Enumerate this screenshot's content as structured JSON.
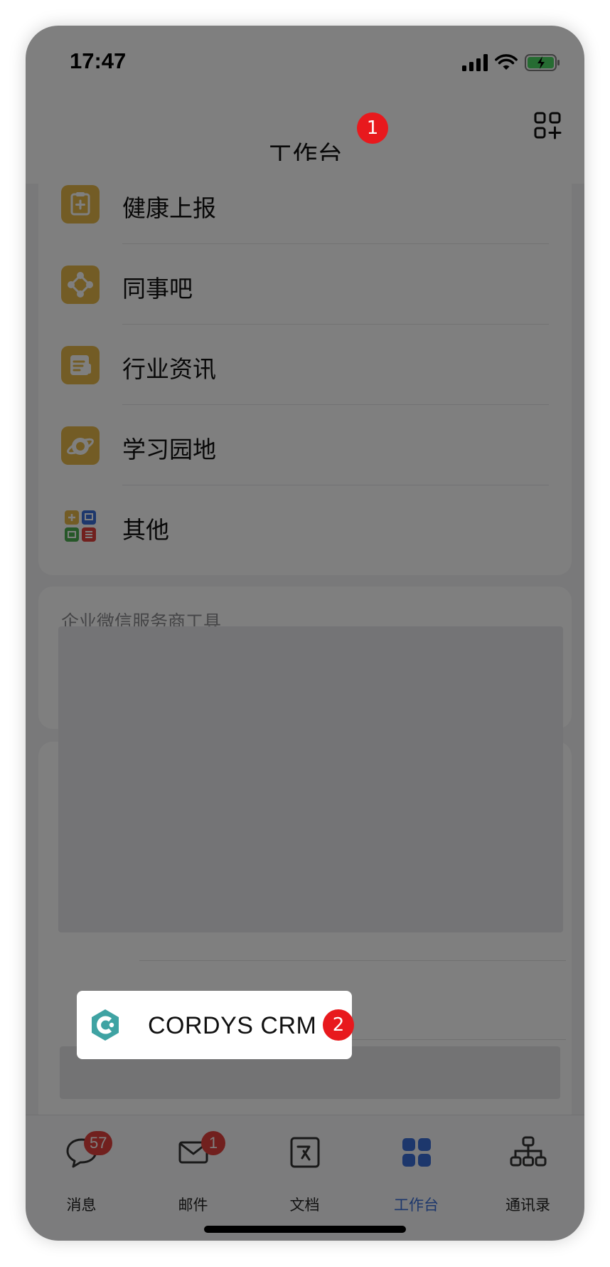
{
  "status_bar": {
    "time": "17:47"
  },
  "header": {
    "title": "工作台"
  },
  "markers": {
    "first": "1",
    "second": "2"
  },
  "apps": [
    {
      "label": "健康上报",
      "icon": "health-report-icon"
    },
    {
      "label": "同事吧",
      "icon": "colleague-icon"
    },
    {
      "label": "行业资讯",
      "icon": "industry-news-icon"
    },
    {
      "label": "学习园地",
      "icon": "learning-icon"
    },
    {
      "label": "其他",
      "icon": "other-apps-icon"
    }
  ],
  "provider_section": {
    "title": "企业微信服务商工具"
  },
  "highlight_item": {
    "label": "CORDYS CRM",
    "icon": "cordys-crm-logo"
  },
  "tabbar": {
    "tabs": [
      {
        "label": "消息",
        "badge": "57"
      },
      {
        "label": "邮件",
        "badge": "1"
      },
      {
        "label": "文档",
        "badge": ""
      },
      {
        "label": "工作台",
        "badge": ""
      },
      {
        "label": "通讯录",
        "badge": ""
      }
    ],
    "active": "工作台"
  },
  "colors": {
    "accent": "#3a6ed8",
    "badge": "#e2403c",
    "marker": "#e8191d",
    "app_icon": "#e7b94a",
    "crm_teal": "#3fa3a3"
  }
}
